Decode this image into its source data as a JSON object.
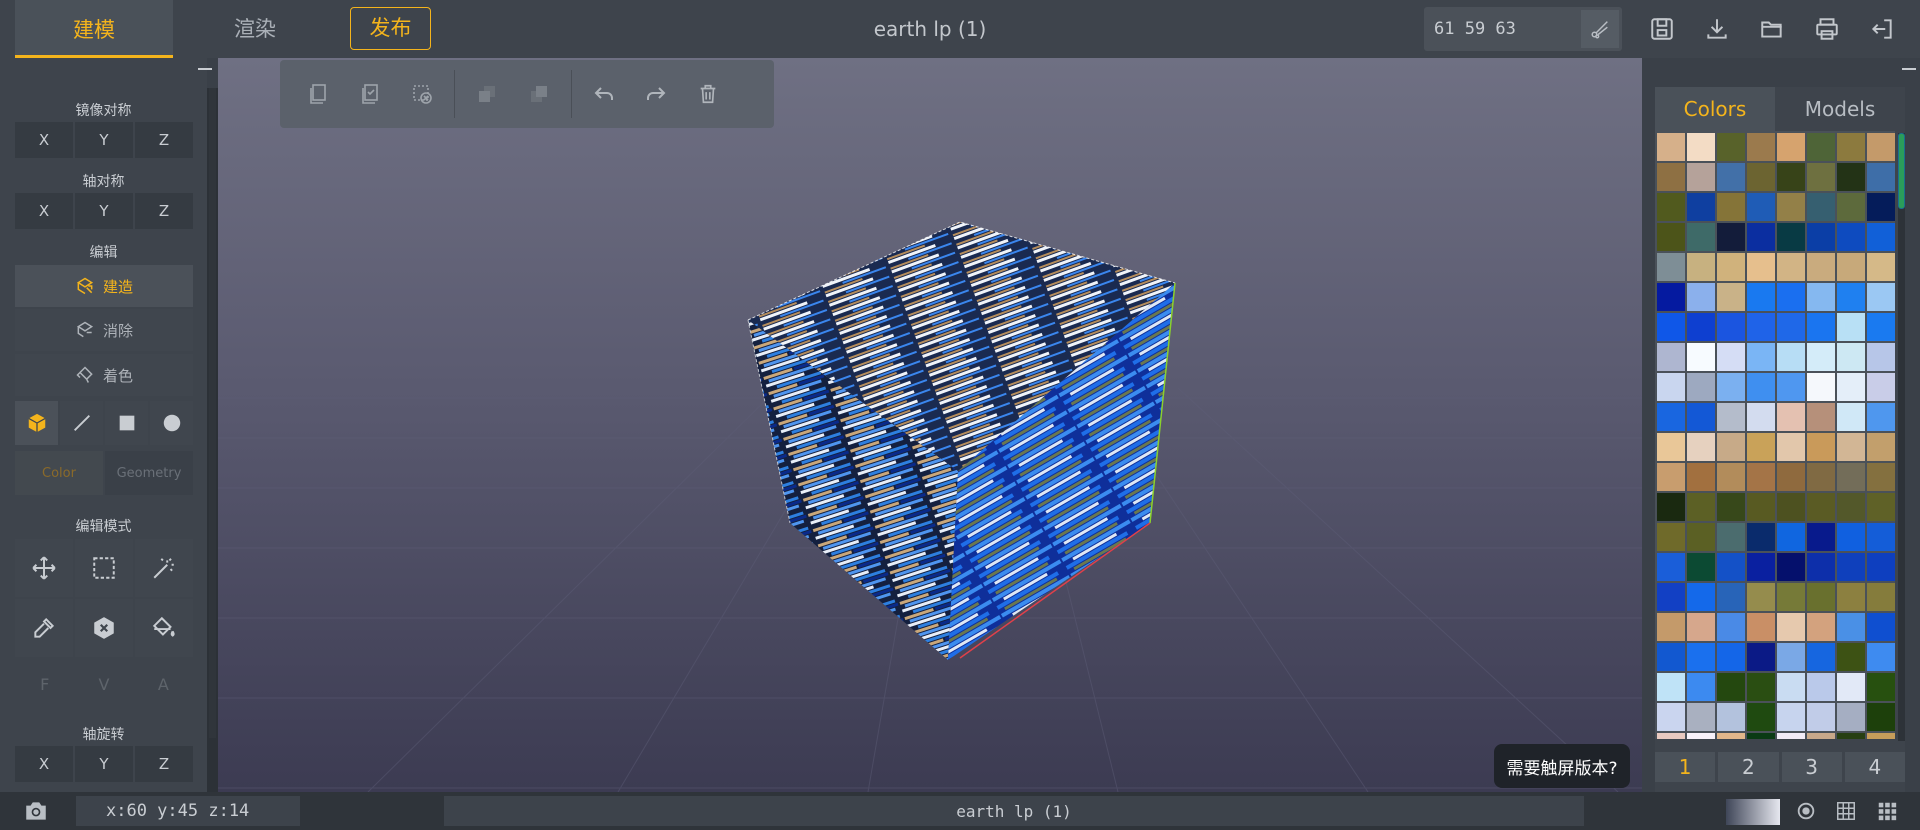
{
  "topbar": {
    "tabs": {
      "model": "建模",
      "render": "渲染",
      "publish": "发布"
    },
    "title": "earth lp (1)",
    "coord_value": "61 59 63"
  },
  "left": {
    "mirror_title": "镜像对称",
    "axis_title": "轴对称",
    "edit_title": "编辑",
    "axes": [
      "X",
      "Y",
      "Z"
    ],
    "edit_buttons": {
      "build": "建造",
      "erase": "消除",
      "paint": "着色"
    },
    "color_tab": "Color",
    "geometry_tab": "Geometry",
    "edit_mode_title": "编辑模式",
    "fva": [
      "F",
      "V",
      "A"
    ],
    "rotate_title": "轴旋转"
  },
  "viewport": {
    "touch_tip": "需要触屏版本?"
  },
  "right": {
    "tabs": {
      "colors": "Colors",
      "models": "Models"
    },
    "pages": [
      "1",
      "2",
      "3",
      "4"
    ],
    "palette": [
      "#d6b08a",
      "#f3dcc5",
      "#58622a",
      "#9b7a4d",
      "#d6a36e",
      "#4e6437",
      "#8c7a3e",
      "#c49a6a",
      "#8e7043",
      "#b5a29a",
      "#4270a8",
      "#6c6431",
      "#374318",
      "#6e7040",
      "#233316",
      "#3e6ea8",
      "#515a1e",
      "#0f3fa0",
      "#857438",
      "#1f5cb6",
      "#938048",
      "#365f70",
      "#5d6a3c",
      "#051c5a",
      "#4c5419",
      "#3e6a68",
      "#131c3a",
      "#0b2ea0",
      "#083a44",
      "#0b3ea6",
      "#0e4bbf",
      "#1160d8",
      "#7e8e96",
      "#c7b180",
      "#d0b27c",
      "#e6bf8d",
      "#d2b485",
      "#c9ab7e",
      "#c7a97a",
      "#d5b988",
      "#051aa0",
      "#8bb0ec",
      "#c9b288",
      "#1979f0",
      "#1a6ff0",
      "#85b8f0",
      "#1f80f0",
      "#9bc8f3",
      "#0f57e8",
      "#0e3fd0",
      "#1b55e0",
      "#1f63e8",
      "#1f68e8",
      "#1a75f0",
      "#b8e0f5",
      "#1a7af0",
      "#aeb6d0",
      "#f7fbff",
      "#d5ddf5",
      "#7ab5f5",
      "#b7ddf5",
      "#d4ecf9",
      "#cde8f3",
      "#b7c6e8",
      "#c9d6ef",
      "#9da9c0",
      "#7bb0f0",
      "#3f8ff0",
      "#4f97f0",
      "#f5f8fc",
      "#e4eef9",
      "#c9cde8",
      "#1966e0",
      "#1358d6",
      "#b4bccb",
      "#d3dcef",
      "#e4c1b1",
      "#b6907a",
      "#d0e8f7",
      "#4f97ee",
      "#e9c798",
      "#e6d1bf",
      "#c7aa88",
      "#c9a259",
      "#e2c7ab",
      "#c99a5a",
      "#d2b695",
      "#c29f6c",
      "#c89d6e",
      "#a2703f",
      "#b28c5b",
      "#a47447",
      "#8f6a3e",
      "#806a43",
      "#736d59",
      "#84703f",
      "#1a2910",
      "#5c6025",
      "#37481a",
      "#585a22",
      "#4d5120",
      "#5a5b24",
      "#53582a",
      "#5f6127",
      "#6f6a2a",
      "#5b6024",
      "#4b6c6e",
      "#0a2b6c",
      "#1066e0",
      "#081a8c",
      "#1060e0",
      "#145dd8",
      "#1a5ed9",
      "#0c4a33",
      "#1451c7",
      "#0a20a0",
      "#05106c",
      "#0d2faa",
      "#0f40bc",
      "#0e3fbf",
      "#1240c4",
      "#1469ea",
      "#2864b8",
      "#958c4d",
      "#767a38",
      "#69702e",
      "#8c8040",
      "#857c3c",
      "#c49a6a",
      "#d6a78c",
      "#4a8ae6",
      "#c98f66",
      "#e6c9ae",
      "#d3a27e",
      "#4a90e6",
      "#0f4fd0",
      "#1258d0",
      "#1a70ee",
      "#1466e8",
      "#0b1a86",
      "#7aa8e6",
      "#1666e0",
      "#3d5214",
      "#3e8bf0",
      "#bfe3f7",
      "#3c8af0",
      "#24480f",
      "#2a4e12",
      "#c9dcf2",
      "#bac9ea",
      "#e2e9f7",
      "#27500f",
      "#cad5ef",
      "#a9b0c0",
      "#b3c2dd",
      "#1f4a10",
      "#c7d4ee",
      "#c1cce8",
      "#a5aec2",
      "#1d400b",
      "#e8c9c0",
      "#f7f1f9",
      "#e2b68a",
      "#0a3a14",
      "#f1ebf6",
      "#c8a88a",
      "#273f13",
      "#c69d5a"
    ]
  },
  "status": {
    "coords": "x:60 y:45 z:14",
    "name": "earth lp (1)"
  }
}
